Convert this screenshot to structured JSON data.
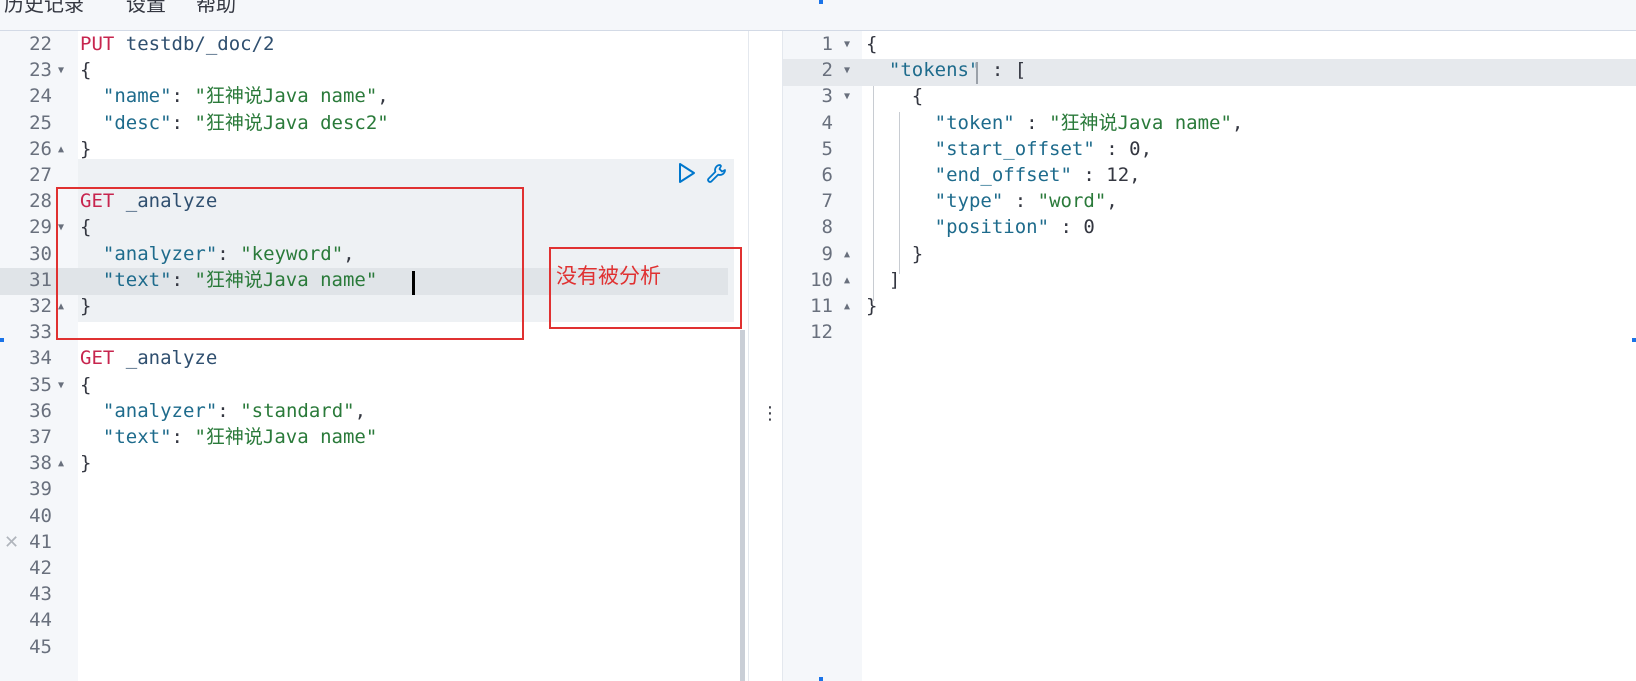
{
  "menu": [
    "历史记录",
    "设置",
    "帮助"
  ],
  "annotation": "没有被分析",
  "icons": {
    "play": "play-icon",
    "wrench": "wrench-icon",
    "close": "close-icon",
    "more": "more-vertical-icon"
  },
  "colors": {
    "annotation": "#e03131",
    "method": "#c7254e",
    "key": "#1e6b8c",
    "string": "#2a7a3a"
  },
  "request_lines": [
    {
      "n": "22",
      "text": "PUT testdb/_doc/2"
    },
    {
      "n": "23",
      "text": "{"
    },
    {
      "n": "24",
      "text": "  \"name\": \"狂神说Java name\","
    },
    {
      "n": "25",
      "text": "  \"desc\": \"狂神说Java desc2\""
    },
    {
      "n": "26",
      "text": "}"
    },
    {
      "n": "27",
      "text": ""
    },
    {
      "n": "28",
      "text": "GET _analyze"
    },
    {
      "n": "29",
      "text": "{"
    },
    {
      "n": "30",
      "text": "  \"analyzer\": \"keyword\","
    },
    {
      "n": "31",
      "text": "  \"text\": \"狂神说Java name\""
    },
    {
      "n": "32",
      "text": "}"
    },
    {
      "n": "33",
      "text": ""
    },
    {
      "n": "34",
      "text": "GET _analyze"
    },
    {
      "n": "35",
      "text": "{"
    },
    {
      "n": "36",
      "text": "  \"analyzer\": \"standard\","
    },
    {
      "n": "37",
      "text": "  \"text\": \"狂神说Java name\""
    },
    {
      "n": "38",
      "text": "}"
    },
    {
      "n": "39",
      "text": ""
    },
    {
      "n": "40",
      "text": ""
    },
    {
      "n": "41",
      "text": ""
    },
    {
      "n": "42",
      "text": ""
    },
    {
      "n": "43",
      "text": ""
    },
    {
      "n": "44",
      "text": ""
    },
    {
      "n": "45",
      "text": ""
    }
  ],
  "response_lines": [
    {
      "n": "1",
      "text": "{"
    },
    {
      "n": "2",
      "text": "  \"tokens\" : ["
    },
    {
      "n": "3",
      "text": "    {"
    },
    {
      "n": "4",
      "text": "      \"token\" : \"狂神说Java name\","
    },
    {
      "n": "5",
      "text": "      \"start_offset\" : 0,"
    },
    {
      "n": "6",
      "text": "      \"end_offset\" : 12,"
    },
    {
      "n": "7",
      "text": "      \"type\" : \"word\","
    },
    {
      "n": "8",
      "text": "      \"position\" : 0"
    },
    {
      "n": "9",
      "text": "    }"
    },
    {
      "n": "10",
      "text": "  ]"
    },
    {
      "n": "11",
      "text": "}"
    },
    {
      "n": "12",
      "text": ""
    }
  ]
}
